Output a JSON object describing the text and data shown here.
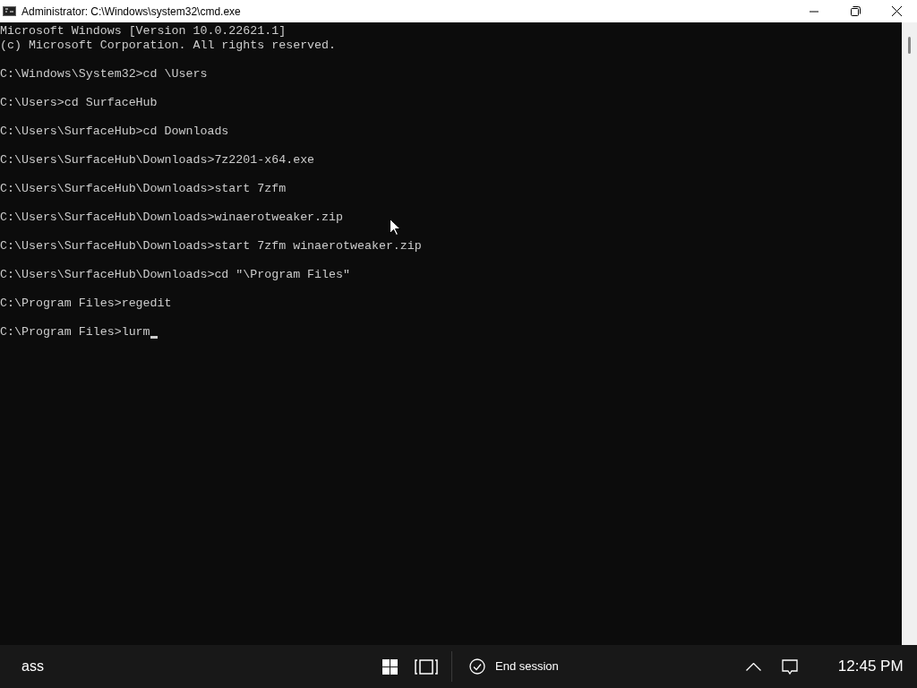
{
  "window": {
    "title": "Administrator: C:\\Windows\\system32\\cmd.exe"
  },
  "console": {
    "header": [
      "Microsoft Windows [Version 10.0.22621.1]",
      "(c) Microsoft Corporation. All rights reserved."
    ],
    "commands": [
      {
        "prompt": "C:\\Windows\\System32>",
        "command": "cd \\Users",
        "cursor": false
      },
      {
        "prompt": "C:\\Users>",
        "command": "cd SurfaceHub",
        "cursor": false
      },
      {
        "prompt": "C:\\Users\\SurfaceHub>",
        "command": "cd Downloads",
        "cursor": false
      },
      {
        "prompt": "C:\\Users\\SurfaceHub\\Downloads>",
        "command": "7z2201-x64.exe",
        "cursor": false
      },
      {
        "prompt": "C:\\Users\\SurfaceHub\\Downloads>",
        "command": "start 7zfm",
        "cursor": false
      },
      {
        "prompt": "C:\\Users\\SurfaceHub\\Downloads>",
        "command": "winaerotweaker.zip",
        "cursor": false
      },
      {
        "prompt": "C:\\Users\\SurfaceHub\\Downloads>",
        "command": "start 7zfm winaerotweaker.zip",
        "cursor": false
      },
      {
        "prompt": "C:\\Users\\SurfaceHub\\Downloads>",
        "command": "cd \"\\Program Files\"",
        "cursor": false
      },
      {
        "prompt": "C:\\Program Files>",
        "command": "regedit",
        "cursor": false
      },
      {
        "prompt": "C:\\Program Files>",
        "command": "lurm",
        "cursor": true
      }
    ]
  },
  "taskbar": {
    "app_name": "ass",
    "end_session": "End session",
    "clock": "12:45 PM"
  }
}
